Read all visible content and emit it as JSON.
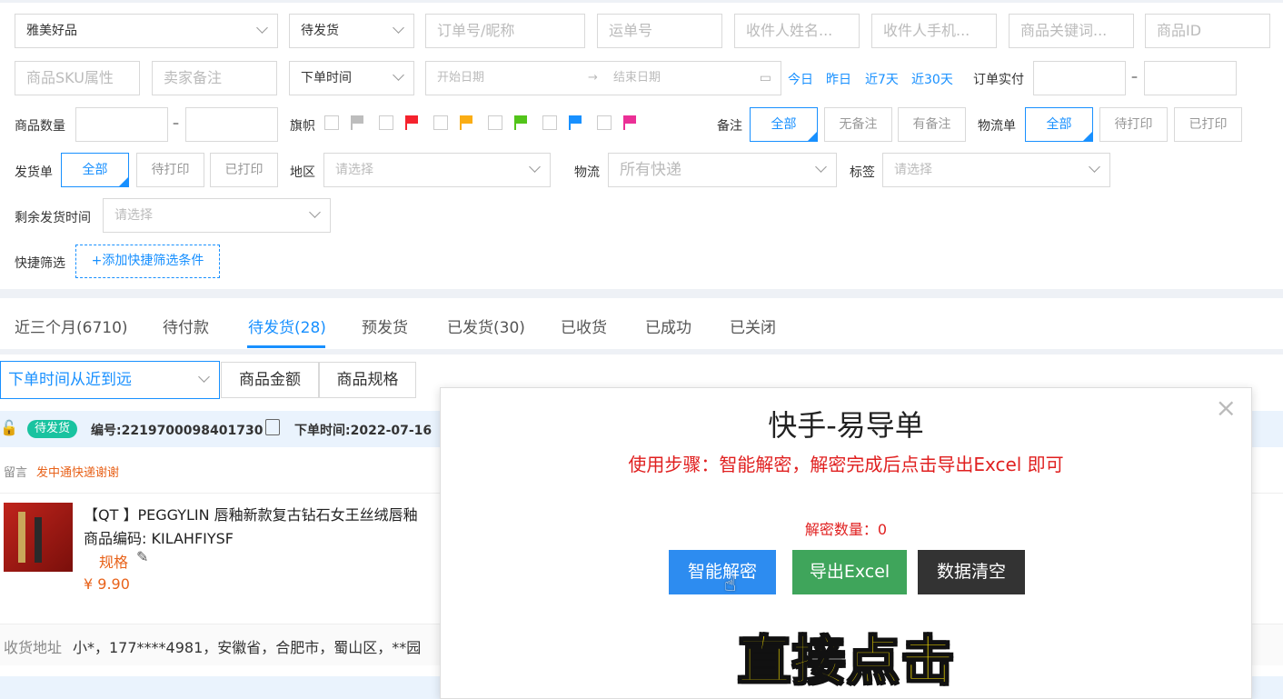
{
  "filters": {
    "shop": "雅美好品",
    "status": "待发货",
    "order_no_placeholder": "订单号/昵称",
    "waybill_placeholder": "运单号",
    "receiver_name_placeholder": "收件人姓名...",
    "receiver_phone_placeholder": "收件人手机...",
    "product_keyword_placeholder": "商品关键词...",
    "product_id_placeholder": "商品ID",
    "sku_placeholder": "商品SKU属性",
    "seller_note_placeholder": "卖家备注",
    "time_type": "下单时间",
    "start_date_placeholder": "开始日期",
    "end_date_placeholder": "结束日期",
    "quick_dates": [
      "今日",
      "昨日",
      "近7天",
      "近30天"
    ],
    "paid_label": "订单实付",
    "dash": "–",
    "qty_label": "商品数量",
    "flag_label": "旗帜",
    "flag_colors": [
      "#bdbdbd",
      "#f5222d",
      "#faad14",
      "#52c41a",
      "#1890ff",
      "#eb2f96"
    ],
    "remark_label": "备注",
    "remark_options": [
      "全部",
      "无备注",
      "有备注"
    ],
    "logistics_bill_label": "物流单",
    "logistics_bill_options": [
      "全部",
      "待打印",
      "已打印"
    ],
    "ship_bill_label": "发货单",
    "ship_bill_options": [
      "全部",
      "待打印",
      "已打印"
    ],
    "region_label": "地区",
    "region_placeholder": "请选择",
    "logistics_label": "物流",
    "logistics_value": "所有快递",
    "tag_label": "标签",
    "tag_placeholder": "请选择",
    "remaining_label": "剩余发货时间",
    "remaining_placeholder": "请选择",
    "quick_filter_label": "快捷筛选",
    "add_quick_filter": "+添加快捷筛选条件"
  },
  "tabs": [
    "近三个月(6710)",
    "待付款",
    "待发货(28)",
    "预发货",
    "已发货(30)",
    "已收货",
    "已成功",
    "已关闭"
  ],
  "active_tab": 2,
  "sort": {
    "value": "下单时间从近到远",
    "buttons": [
      "商品金额",
      "商品规格"
    ]
  },
  "order": {
    "status_badge": "待发货",
    "order_no": "编号:2219700098401730",
    "order_time": "下单时间:2022-07-16",
    "message_label": "留言",
    "message": "发中通快递谢谢",
    "product_title": "【QT 】PEGGYLIN 唇釉新款复古钻石女王丝绒唇釉",
    "product_code": "商品编码: KILAHFIYSF",
    "spec_label": "规格",
    "price": "¥ 9.90",
    "address_label": "收货地址",
    "address": "小*，177****4981，安徽省，合肥市，蜀山区，**园"
  },
  "modal": {
    "title": "快手-易导单",
    "steps": "使用步骤：智能解密，解密完成后点击导出Excel 即可",
    "count_label": "解密数量：0",
    "buttons": [
      "智能解密",
      "导出Excel",
      "数据清空"
    ],
    "button_colors": [
      "#2d8cf0",
      "#3fa55b",
      "#333333"
    ]
  },
  "caption": "直接点击"
}
